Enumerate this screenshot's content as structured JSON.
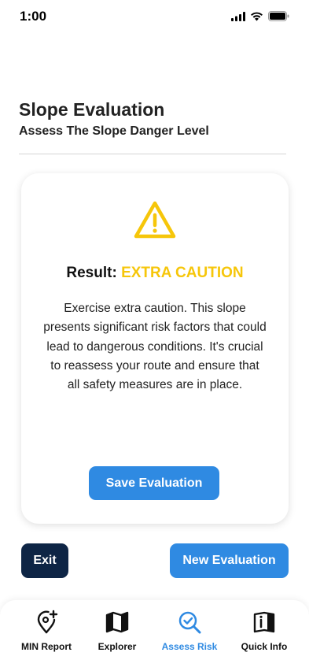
{
  "status_bar": {
    "time": "1:00"
  },
  "header": {
    "title": "Slope Evaluation",
    "subtitle": "Assess The Slope Danger Level"
  },
  "result_card": {
    "result_label": "Result:",
    "result_value": "EXTRA CAUTION",
    "description": "Exercise extra caution. This slope presents significant risk factors that could lead to dangerous conditions. It's crucial to reassess your route and ensure that all safety measures are in place.",
    "save_label": "Save Evaluation",
    "icon": "warning-triangle-icon",
    "accent_color": "#f6c60a"
  },
  "actions": {
    "exit_label": "Exit",
    "new_label": "New Evaluation"
  },
  "tabs": [
    {
      "label": "MIN Report",
      "icon": "location-plus-icon",
      "active": false
    },
    {
      "label": "Explorer",
      "icon": "map-icon",
      "active": false
    },
    {
      "label": "Assess Risk",
      "icon": "search-check-icon",
      "active": true
    },
    {
      "label": "Quick Info",
      "icon": "info-book-icon",
      "active": false
    }
  ],
  "colors": {
    "primary": "#2f8ae2",
    "dark": "#0e2545",
    "warning": "#f6c60a"
  }
}
